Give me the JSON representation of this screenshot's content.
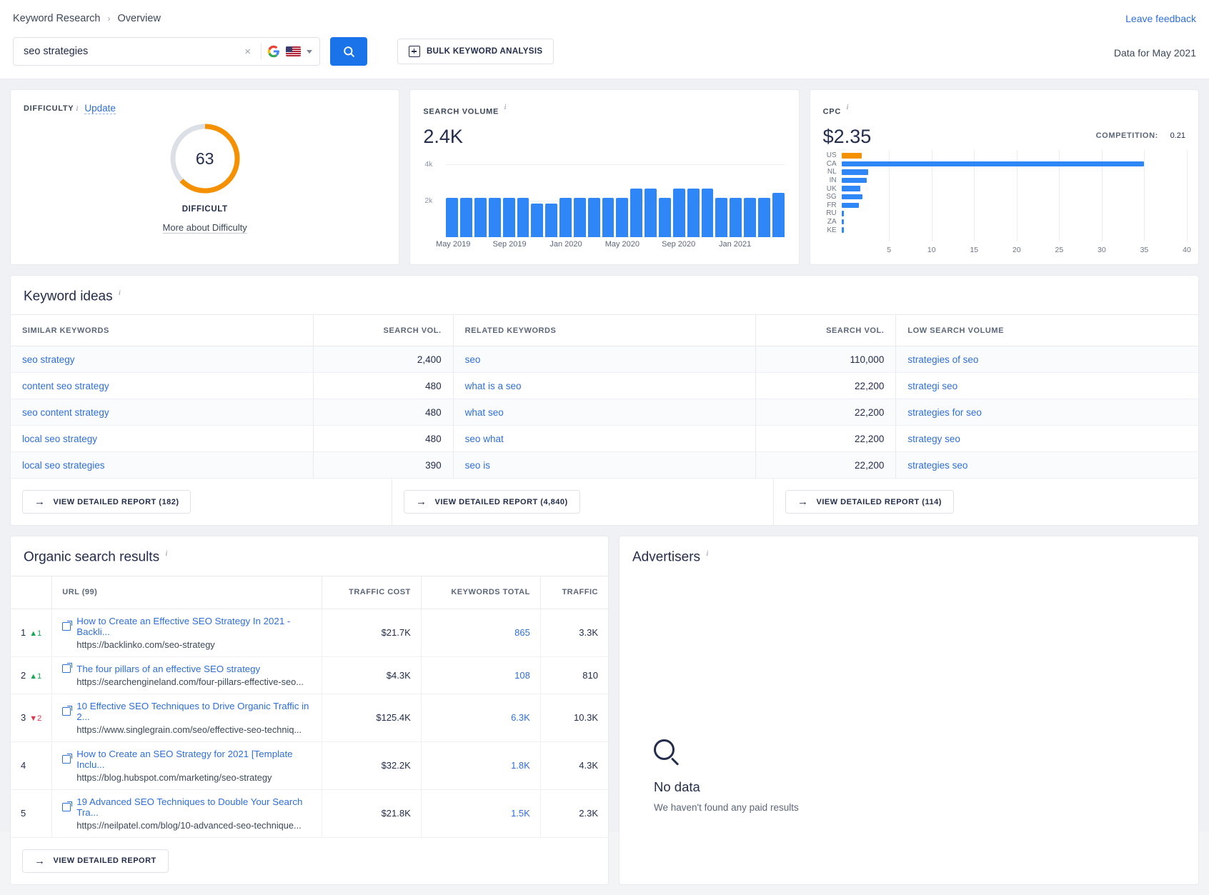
{
  "header": {
    "breadcrumb": [
      "Keyword Research",
      "Overview"
    ],
    "breadcrumb_separator": "›",
    "feedback_link": "Leave feedback",
    "data_for": "Data for May 2021"
  },
  "search": {
    "value": "seo strategies",
    "placeholder": "Enter keyword",
    "clear_label": "×",
    "engine": "Google",
    "country": "US",
    "search_button_label": "Search",
    "bulk_button_label": "BULK KEYWORD ANALYSIS"
  },
  "difficulty": {
    "label": "DIFFICULTY",
    "update_link": "Update",
    "value": "63",
    "percent": 63,
    "verdict": "DIFFICULT",
    "more_link": "More about Difficulty",
    "arc_color": "#f59100",
    "track_color": "#dcdfe5"
  },
  "search_volume": {
    "label": "SEARCH VOLUME",
    "value": "2.4K"
  },
  "cpc": {
    "label": "CPC",
    "value": "$2.35",
    "competition_label": "COMPETITION:",
    "competition_value": "0.21"
  },
  "chart_data": [
    {
      "type": "bar",
      "title": "SEARCH VOLUME",
      "xlabel": "",
      "ylabel": "",
      "ylim": [
        0,
        4400
      ],
      "yticks": [
        "2k",
        "4k"
      ],
      "ytick_values": [
        2000,
        4000
      ],
      "grid": true,
      "categories": [
        "May 2019",
        "Jun 2019",
        "Jul 2019",
        "Aug 2019",
        "Sep 2019",
        "Oct 2019",
        "Nov 2019",
        "Dec 2019",
        "Jan 2020",
        "Feb 2020",
        "Mar 2020",
        "Apr 2020",
        "May 2020",
        "Jun 2020",
        "Jul 2020",
        "Aug 2020",
        "Sep 2020",
        "Oct 2020",
        "Nov 2020",
        "Dec 2020",
        "Jan 2021",
        "Feb 2021",
        "Mar 2021",
        "Apr 2021"
      ],
      "tick_labels": [
        "May 2019",
        "Sep 2019",
        "Jan 2020",
        "May 2020",
        "Sep 2020",
        "Jan 2021"
      ],
      "tick_label_indexes": [
        0,
        4,
        8,
        12,
        16,
        20
      ],
      "values": [
        2180,
        2180,
        2180,
        2180,
        2180,
        2180,
        1830,
        1830,
        2180,
        2180,
        2180,
        2180,
        2180,
        2680,
        2680,
        2180,
        2680,
        2680,
        2680,
        2180,
        2180,
        2180,
        2180,
        2450
      ],
      "bar_color": "#2f86f6"
    },
    {
      "type": "bar",
      "orientation": "horizontal",
      "title": "CPC distribution by country",
      "xlabel": "",
      "ylabel": "",
      "xlim": [
        0,
        40
      ],
      "xticks": [
        5,
        10,
        15,
        20,
        25,
        30,
        35,
        40
      ],
      "grid": true,
      "categories": [
        "US",
        "CA",
        "NL",
        "IN",
        "UK",
        "SG",
        "FR",
        "RU",
        "ZA",
        "KE"
      ],
      "values": [
        2.35,
        35.0,
        3.1,
        2.9,
        2.2,
        2.4,
        2.0,
        0.28,
        0.22,
        0.18
      ],
      "bar_color": "#2f86f6",
      "highlight_index": 0,
      "highlight_color": "#f59100"
    }
  ],
  "keyword_ideas": {
    "title": "Keyword ideas",
    "columns": [
      {
        "key": "similar",
        "label": "SIMILAR KEYWORDS"
      },
      {
        "key": "similar_vol",
        "label": "SEARCH VOL."
      },
      {
        "key": "related",
        "label": "RELATED KEYWORDS"
      },
      {
        "key": "related_vol",
        "label": "SEARCH VOL."
      },
      {
        "key": "low",
        "label": "LOW SEARCH VOLUME"
      }
    ],
    "similar_keywords": [
      {
        "keyword": "seo strategy",
        "volume": "2,400"
      },
      {
        "keyword": "content seo strategy",
        "volume": "480"
      },
      {
        "keyword": "seo content strategy",
        "volume": "480"
      },
      {
        "keyword": "local seo strategy",
        "volume": "480"
      },
      {
        "keyword": "local seo strategies",
        "volume": "390"
      }
    ],
    "related_keywords": [
      {
        "keyword": "seo",
        "volume": "110,000"
      },
      {
        "keyword": "what is a seo",
        "volume": "22,200"
      },
      {
        "keyword": "what seo",
        "volume": "22,200"
      },
      {
        "keyword": "seo what",
        "volume": "22,200"
      },
      {
        "keyword": "seo is",
        "volume": "22,200"
      }
    ],
    "low_search_volume": [
      {
        "keyword": "strategies of seo"
      },
      {
        "keyword": "strategi seo"
      },
      {
        "keyword": "strategies for seo"
      },
      {
        "keyword": "strategy seo"
      },
      {
        "keyword": "strategies seo"
      }
    ],
    "buttons": [
      "VIEW DETAILED REPORT (182)",
      "VIEW DETAILED REPORT (4,840)",
      "VIEW DETAILED REPORT (114)"
    ]
  },
  "organic": {
    "title": "Organic search results",
    "columns": [
      "",
      "URL (99)",
      "TRAFFIC COST",
      "KEYWORDS TOTAL",
      "TRAFFIC"
    ],
    "rows": [
      {
        "rank": "1",
        "delta": "1",
        "delta_dir": "up",
        "title": "How to Create an Effective SEO Strategy In 2021 - Backli...",
        "url": "https://backlinko.com/seo-strategy",
        "traffic_cost": "$21.7K",
        "keywords_total": "865",
        "traffic": "3.3K"
      },
      {
        "rank": "2",
        "delta": "1",
        "delta_dir": "up",
        "title": "The four pillars of an effective SEO strategy",
        "url": "https://searchengineland.com/four-pillars-effective-seo...",
        "traffic_cost": "$4.3K",
        "keywords_total": "108",
        "traffic": "810"
      },
      {
        "rank": "3",
        "delta": "2",
        "delta_dir": "down",
        "title": "10 Effective SEO Techniques to Drive Organic Traffic in 2...",
        "url": "https://www.singlegrain.com/seo/effective-seo-techniq...",
        "traffic_cost": "$125.4K",
        "keywords_total": "6.3K",
        "traffic": "10.3K"
      },
      {
        "rank": "4",
        "delta": "",
        "delta_dir": "",
        "title": "How to Create an SEO Strategy for 2021 [Template Inclu...",
        "url": "https://blog.hubspot.com/marketing/seo-strategy",
        "traffic_cost": "$32.2K",
        "keywords_total": "1.8K",
        "traffic": "4.3K"
      },
      {
        "rank": "5",
        "delta": "",
        "delta_dir": "",
        "title": "19 Advanced SEO Techniques to Double Your Search Tra...",
        "url": "https://neilpatel.com/blog/10-advanced-seo-technique...",
        "traffic_cost": "$21.8K",
        "keywords_total": "1.5K",
        "traffic": "2.3K"
      }
    ],
    "button": "VIEW DETAILED REPORT"
  },
  "advertisers": {
    "title": "Advertisers",
    "empty_title": "No data",
    "empty_subtitle": "We haven't found any paid results"
  }
}
